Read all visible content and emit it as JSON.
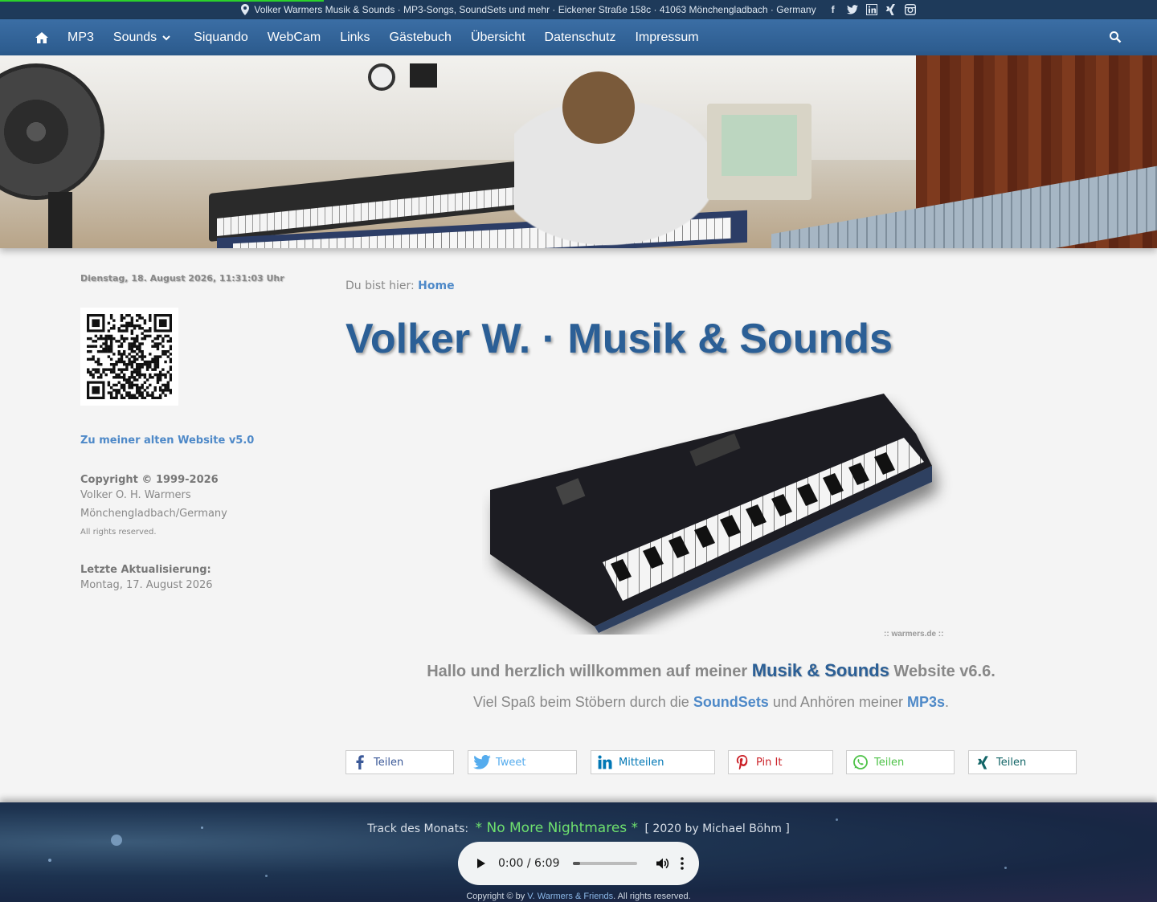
{
  "topbar": {
    "info": "Volker Warmers Musik & Sounds · MP3-Songs, SoundSets und mehr · Eickener Straße 158c · 41063 Mönchengladbach · Germany",
    "socials": [
      "facebook-icon",
      "twitter-icon",
      "linkedin-icon",
      "xing-icon",
      "instagram-icon"
    ]
  },
  "nav": {
    "items": [
      "MP3",
      "Sounds",
      "Siquando",
      "WebCam",
      "Links",
      "Gästebuch",
      "Übersicht",
      "Datenschutz",
      "Impressum"
    ]
  },
  "sidebar": {
    "date": "Dienstag, 18. August 2026, 11:31:03 Uhr",
    "old_site": "Zu meiner alten Website v5.0",
    "copyright_head": "Copyright © 1999-2026",
    "owner": "Volker O. H. Warmers",
    "city": "Mönchengladbach/Germany",
    "rights": "All rights reserved.",
    "updated_head": "Letzte Aktualisierung:",
    "updated_date": "Montag, 17. August 2026"
  },
  "main": {
    "breadcrumb_prefix": "Du bist hier:",
    "breadcrumb_home": "Home",
    "title": "Volker W. · Musik & Sounds",
    "watermark": ":: warmers.de ::",
    "welcome_pre": "Hallo und herzlich willkommen auf meiner",
    "welcome_hl": "Musik & Sounds",
    "welcome_post": "Website v6.6.",
    "enjoy_pre": "Viel Spaß beim Stöbern durch die",
    "enjoy_hl1": "SoundSets",
    "enjoy_mid": "und Anhören meiner",
    "enjoy_hl2": "MP3s",
    "enjoy_end": "."
  },
  "share": [
    {
      "label": "Teilen",
      "color": "#3b5998"
    },
    {
      "label": "Tweet",
      "color": "#55acee"
    },
    {
      "label": "Mitteilen",
      "color": "#0077b5"
    },
    {
      "label": "Pin It",
      "color": "#cb2027"
    },
    {
      "label": "Teilen",
      "color": "#4dc247"
    },
    {
      "label": "Teilen",
      "color": "#126567"
    }
  ],
  "footer": {
    "track_label": "Track des Monats:",
    "track_name": "* No More Nightmares *",
    "track_info": "[ 2020 by Michael Böhm ]",
    "player_time": "0:00 / 6:09",
    "player_progress": 0.12,
    "copy_pre": "Copyright © by",
    "copy_link": "V. Warmers & Friends",
    "copy_post": ". All rights reserved."
  }
}
